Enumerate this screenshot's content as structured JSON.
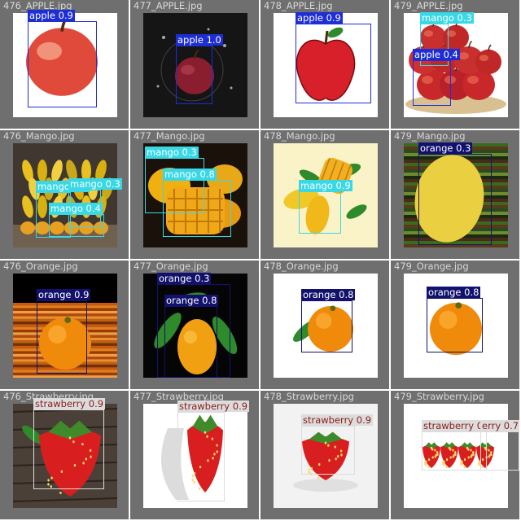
{
  "colors": {
    "apple_box": "#1e2ed6",
    "mango_box": "#38d8e6",
    "orange_box": "#12126e",
    "strawberry_box": "#dcdcdc",
    "apple_label_text": "#ffffff",
    "mango_label_text": "#ffffff",
    "orange_label_text": "#ffffff",
    "strawberry_label_text": "#8a1c1c"
  },
  "tiles": [
    {
      "filename": "476_APPLE.jpg",
      "scene": "apple-single-pink",
      "detections": [
        {
          "label": "apple 0.9",
          "class": "apple"
        }
      ]
    },
    {
      "filename": "477_APPLE.jpg",
      "scene": "apple-dark-splash",
      "detections": [
        {
          "label": "apple 1.0",
          "class": "apple"
        }
      ]
    },
    {
      "filename": "478_APPLE.jpg",
      "scene": "apple-cartoon",
      "detections": [
        {
          "label": "apple 0.9",
          "class": "apple"
        }
      ]
    },
    {
      "filename": "479_APPLE.jpg",
      "scene": "apple-pile",
      "detections": [
        {
          "label": "mango 0.3",
          "class": "mango"
        },
        {
          "label": "apple 0.4",
          "class": "apple"
        }
      ]
    },
    {
      "filename": "476_Mango.jpg",
      "scene": "mango-market",
      "detections": [
        {
          "label": "mango 0.3",
          "class": "mango"
        },
        {
          "label": "mango 0.3",
          "class": "mango"
        },
        {
          "label": "mango 0.4",
          "class": "mango"
        }
      ]
    },
    {
      "filename": "477_Mango.jpg",
      "scene": "mango-cut-dark",
      "detections": [
        {
          "label": "mango 0.3",
          "class": "mango"
        },
        {
          "label": "mango 0.8",
          "class": "mango"
        }
      ]
    },
    {
      "filename": "478_Mango.jpg",
      "scene": "mango-cartoon",
      "detections": [
        {
          "label": "mango 0.9",
          "class": "mango"
        }
      ]
    },
    {
      "filename": "479_Mango.jpg",
      "scene": "mango-stretched",
      "detections": [
        {
          "label": "orange 0.3",
          "class": "orange"
        }
      ]
    },
    {
      "filename": "476_Orange.jpg",
      "scene": "orange-stretched",
      "detections": [
        {
          "label": "orange 0.9",
          "class": "orange"
        }
      ]
    },
    {
      "filename": "477_Orange.jpg",
      "scene": "orange-leaves-dark",
      "detections": [
        {
          "label": "orange 0.3",
          "class": "orange"
        },
        {
          "label": "orange 0.8",
          "class": "orange"
        }
      ]
    },
    {
      "filename": "478_Orange.jpg",
      "scene": "orange-leaf-white",
      "detections": [
        {
          "label": "orange 0.8",
          "class": "orange"
        }
      ]
    },
    {
      "filename": "479_Orange.jpg",
      "scene": "orange-plain",
      "detections": [
        {
          "label": "orange 0.8",
          "class": "orange"
        }
      ]
    },
    {
      "filename": "476_Strawberry.jpg",
      "scene": "strawberry-wood",
      "detections": [
        {
          "label": "strawberry 0.9",
          "class": "strawberry"
        }
      ]
    },
    {
      "filename": "477_Strawberry.jpg",
      "scene": "strawberry-shadow",
      "detections": [
        {
          "label": "strawberry 0.9",
          "class": "strawberry"
        }
      ]
    },
    {
      "filename": "478_Strawberry.jpg",
      "scene": "strawberry-round",
      "detections": [
        {
          "label": "strawberry 0.9",
          "class": "strawberry"
        }
      ]
    },
    {
      "filename": "479_Strawberry.jpg",
      "scene": "strawberry-row",
      "detections": [
        {
          "label": "strawberry 0.7",
          "class": "strawberry"
        },
        {
          "label": "erry 0.7",
          "class": "strawberry"
        }
      ]
    }
  ]
}
